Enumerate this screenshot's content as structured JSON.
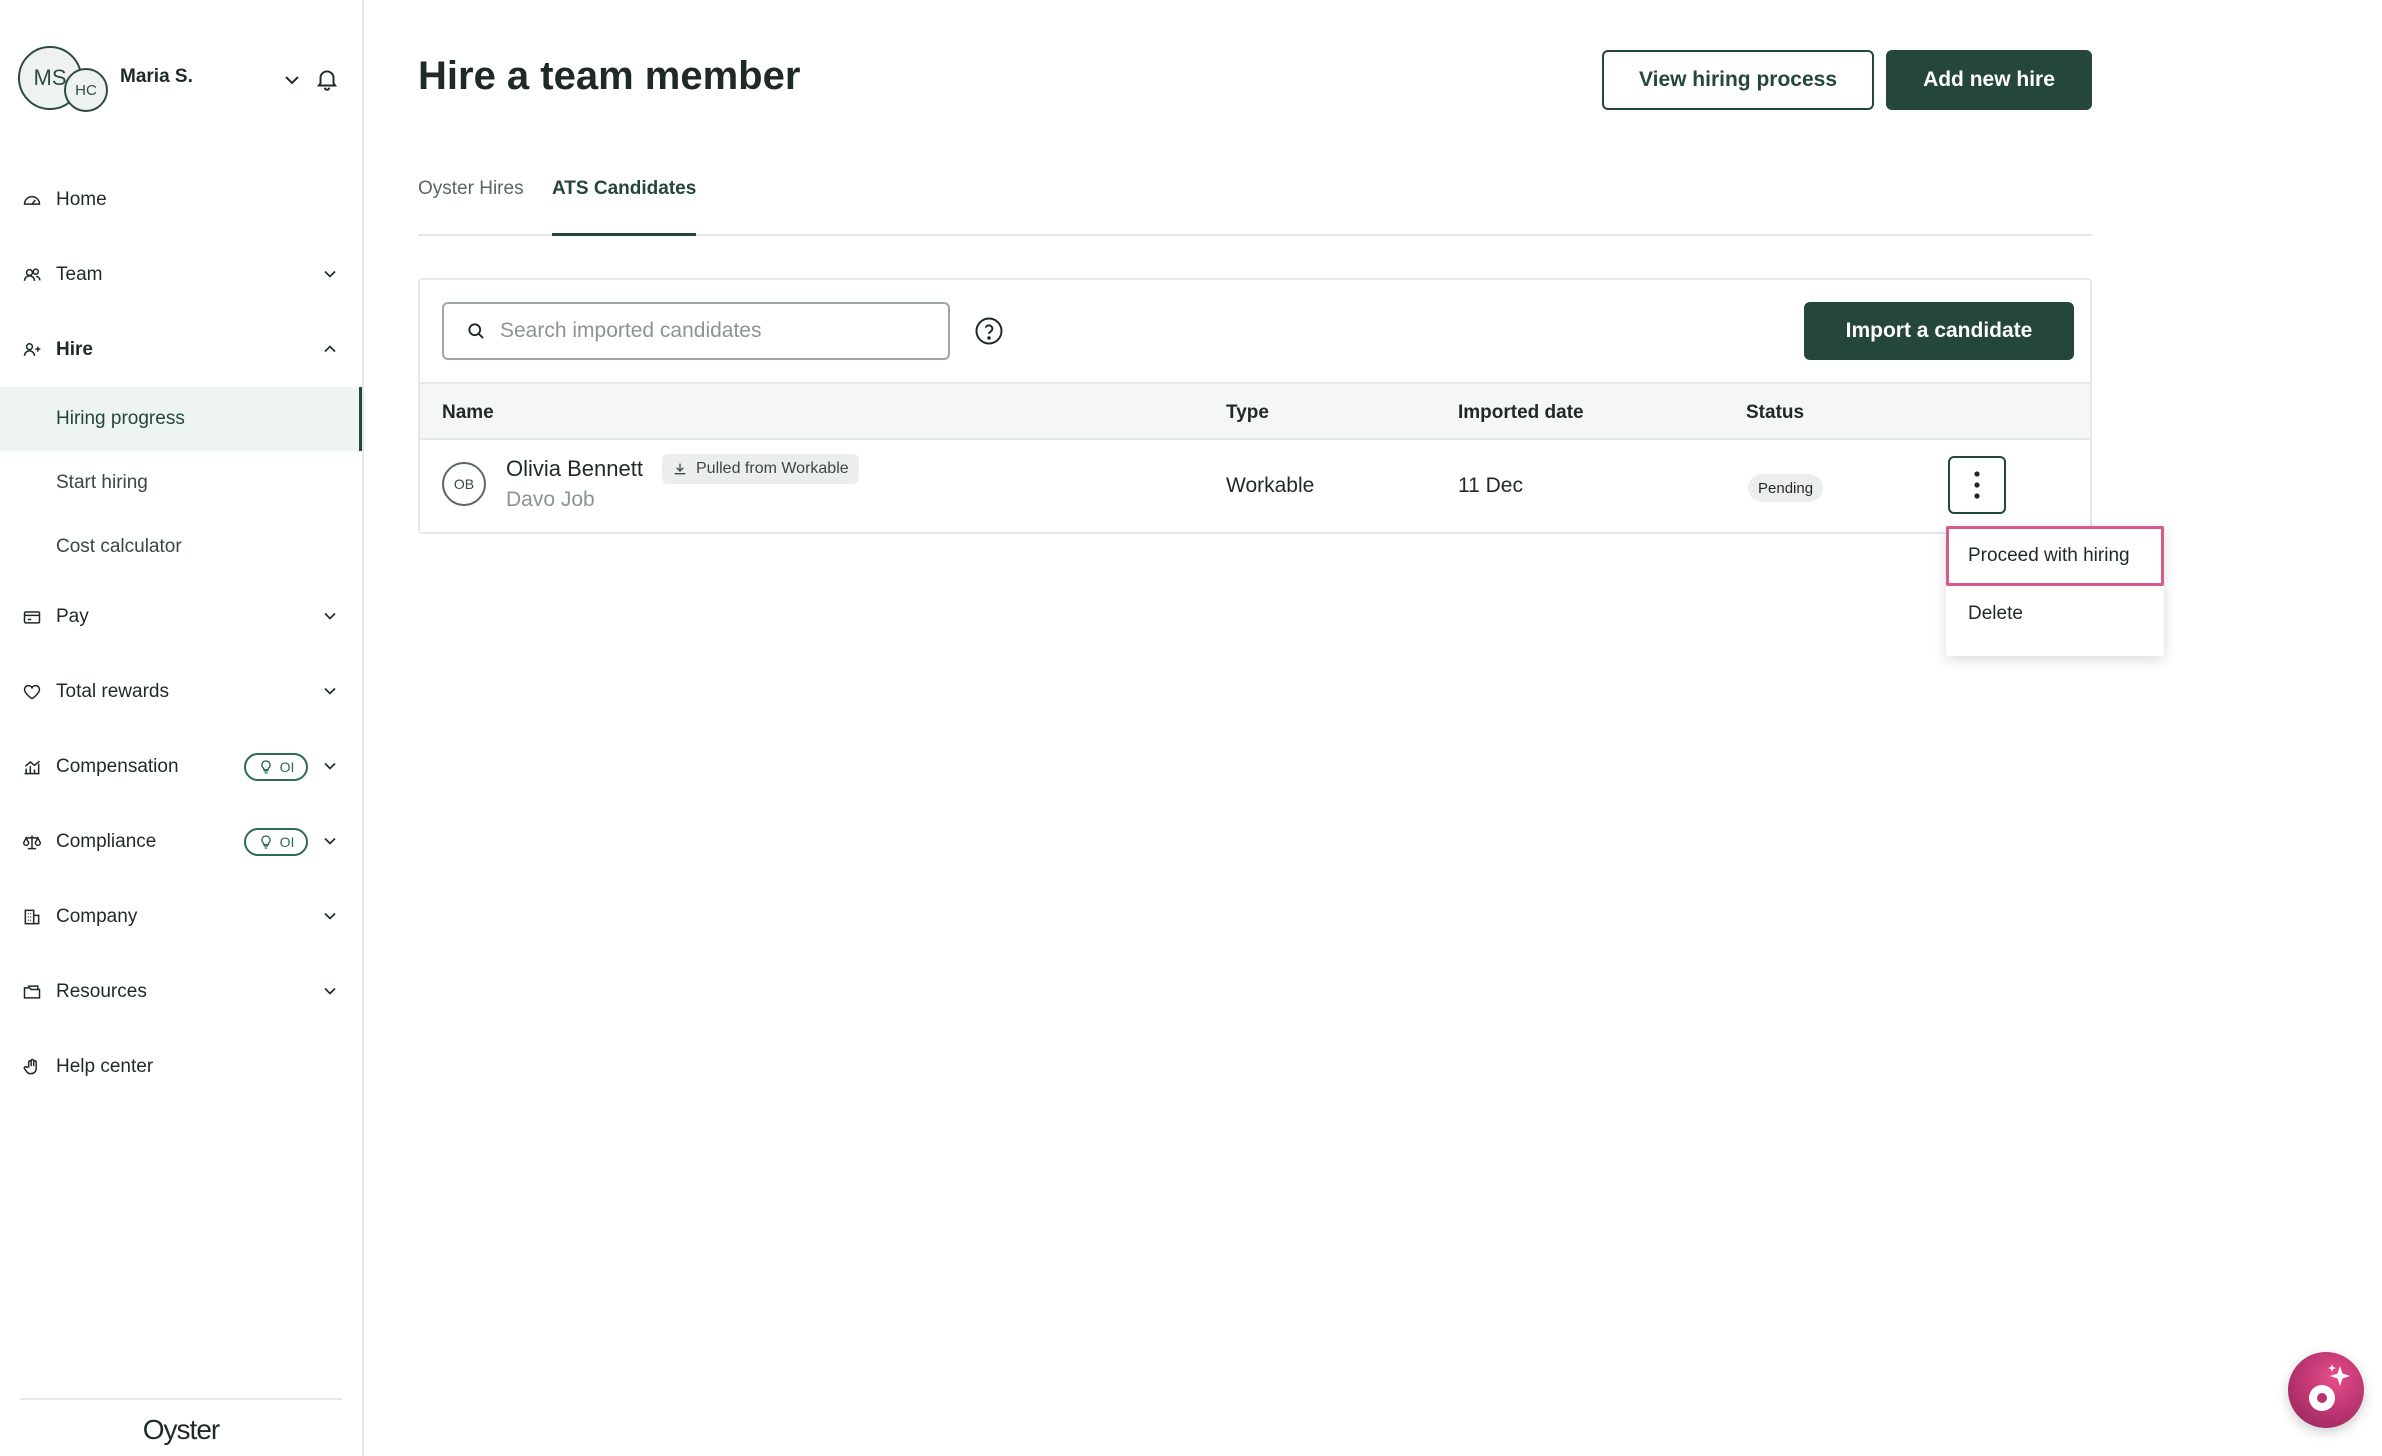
{
  "user": {
    "initials_primary": "MS",
    "initials_secondary": "HC",
    "name": "Maria S."
  },
  "sidebar": {
    "items": [
      {
        "label": "Home",
        "icon": "gauge-icon"
      },
      {
        "label": "Team",
        "icon": "users-icon"
      },
      {
        "label": "Hire",
        "icon": "user-plus-icon"
      },
      {
        "label": "Pay",
        "icon": "wallet-icon"
      },
      {
        "label": "Total rewards",
        "icon": "heart-icon"
      },
      {
        "label": "Compensation",
        "icon": "chart-icon",
        "badge": "OI"
      },
      {
        "label": "Compliance",
        "icon": "scale-icon",
        "badge": "OI"
      },
      {
        "label": "Company",
        "icon": "building-icon"
      },
      {
        "label": "Resources",
        "icon": "folder-icon"
      },
      {
        "label": "Help center",
        "icon": "hand-icon"
      }
    ],
    "hire_subitems": [
      {
        "label": "Hiring progress"
      },
      {
        "label": "Start hiring"
      },
      {
        "label": "Cost calculator"
      }
    ],
    "brand": "Oyster"
  },
  "header": {
    "title": "Hire a team member",
    "view_process_label": "View hiring process",
    "add_hire_label": "Add new hire"
  },
  "tabs": [
    {
      "label": "Oyster Hires"
    },
    {
      "label": "ATS Candidates"
    }
  ],
  "candidates": {
    "search_placeholder": "Search imported candidates",
    "import_label": "Import a candidate",
    "columns": [
      "Name",
      "Type",
      "Imported date",
      "Status"
    ],
    "rows": [
      {
        "initials": "OB",
        "name": "Olivia Bennett",
        "source_badge": "Pulled from Workable",
        "job": "Davo Job",
        "type": "Workable",
        "imported_date": "11 Dec",
        "status": "Pending"
      }
    ]
  },
  "row_menu": {
    "items": [
      {
        "label": "Proceed with hiring"
      },
      {
        "label": "Delete"
      }
    ]
  },
  "colors": {
    "brand_dark": "#24463b",
    "highlight": "#d9588e",
    "assistant": "#c23a76"
  }
}
